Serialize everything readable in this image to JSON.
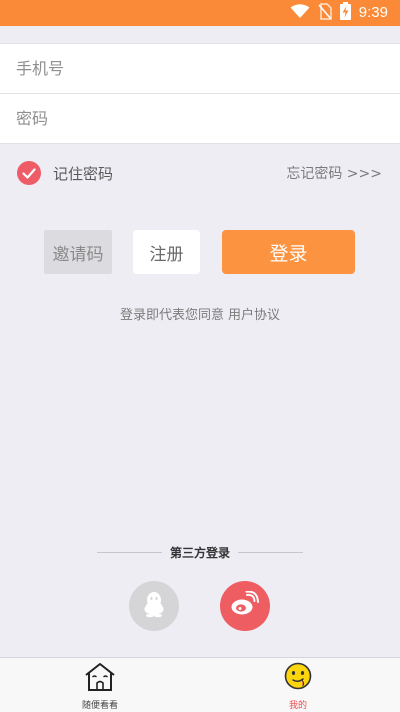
{
  "status_bar": {
    "time": "9:39",
    "background": "#fb8a38",
    "icons": [
      "wifi-icon",
      "no-sim-icon",
      "battery-charging-icon"
    ]
  },
  "login_form": {
    "phone_placeholder": "手机号",
    "password_placeholder": "密码",
    "remember_label": "记住密码",
    "remember_checked": true,
    "forgot_label": "忘记密码 >>>"
  },
  "actions": {
    "invite_label": "邀请码",
    "register_label": "注册",
    "login_label": "登录",
    "login_color": "#fb9341"
  },
  "agreement": {
    "prefix": "登录即代表您同意",
    "link": "用户协议"
  },
  "third_party": {
    "title": "第三方登录",
    "providers": [
      "qq-icon",
      "weibo-icon"
    ]
  },
  "tab_bar": {
    "items": [
      {
        "label": "随便看看",
        "icon": "house-icon",
        "active": false
      },
      {
        "label": "我的",
        "icon": "emoji-face-icon",
        "active": true
      }
    ]
  }
}
